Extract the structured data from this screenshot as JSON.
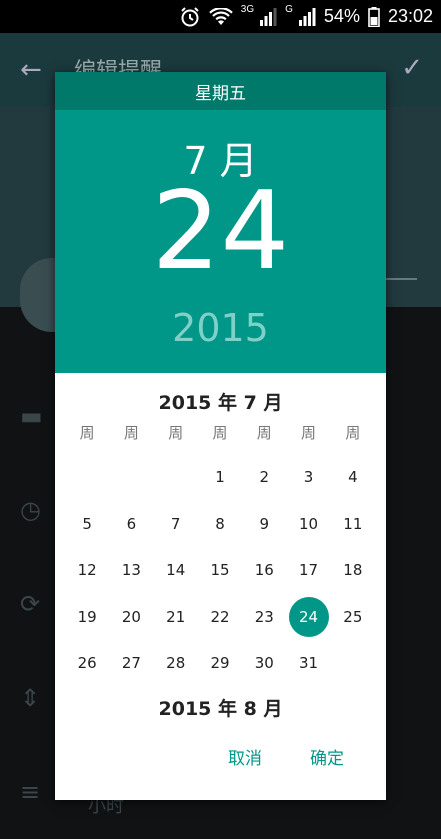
{
  "status_bar": {
    "network1": "3G",
    "network2": "G",
    "battery": "54%",
    "time": "23:02"
  },
  "background_app": {
    "title": "编辑提醒",
    "bottom_text": "小时"
  },
  "dialog": {
    "weekday": "星期五",
    "header_month": "7 月",
    "header_date": "24",
    "header_year": "2015",
    "current_month_title": "2015 年 7 月",
    "next_month_title": "2015 年 8 月",
    "weekday_headers": [
      "周",
      "周",
      "周",
      "周",
      "周",
      "周",
      "周"
    ],
    "days": [
      "",
      "",
      "",
      "1",
      "2",
      "3",
      "4",
      "5",
      "6",
      "7",
      "8",
      "9",
      "10",
      "11",
      "12",
      "13",
      "14",
      "15",
      "16",
      "17",
      "18",
      "19",
      "20",
      "21",
      "22",
      "23",
      "24",
      "25",
      "26",
      "27",
      "28",
      "29",
      "30",
      "31",
      ""
    ],
    "selected_day": "24",
    "cancel_label": "取消",
    "ok_label": "确定"
  },
  "colors": {
    "accent": "#009688",
    "accent_dark": "#00796b",
    "year_text": "#7fd1c7"
  }
}
